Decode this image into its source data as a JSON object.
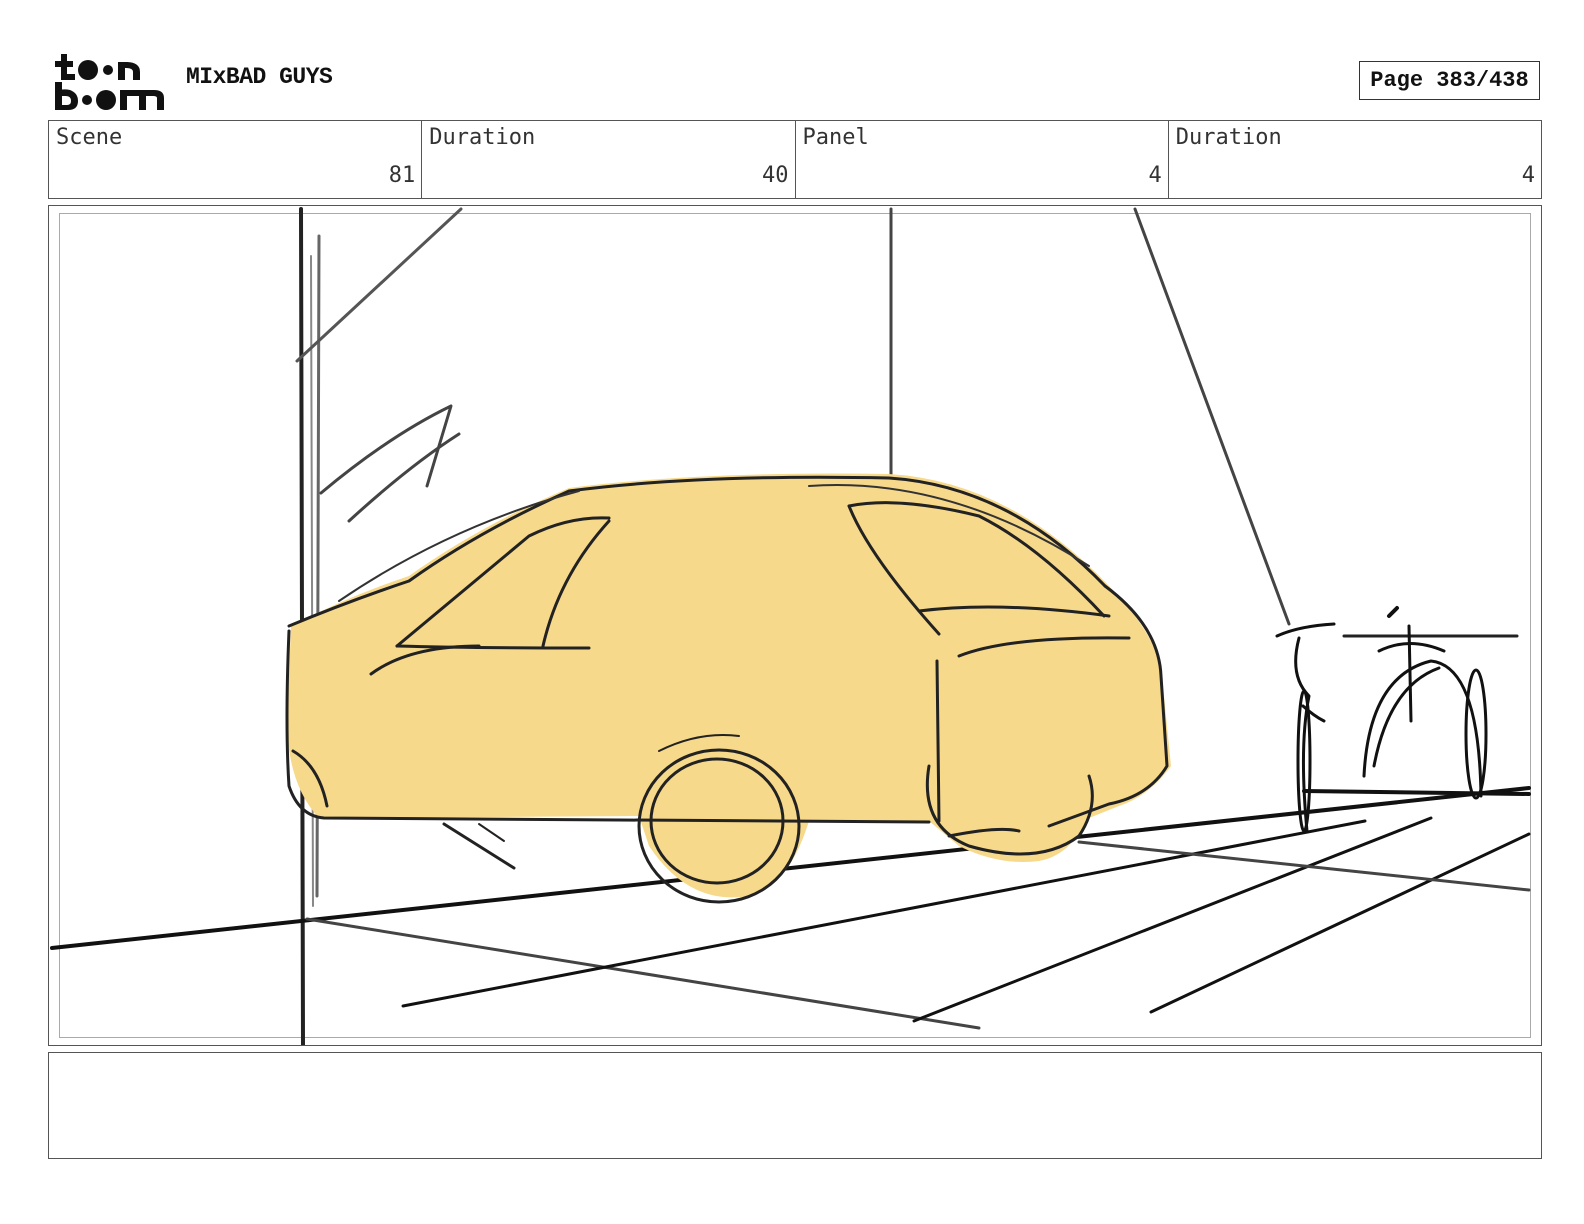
{
  "header": {
    "logo_alt": "toon boom",
    "project_title": "MIxBAD GUYS",
    "page_label": "Page 383/438"
  },
  "info": {
    "scene_label": "Scene",
    "scene_value": "81",
    "scene_duration_label": "Duration",
    "scene_duration_value": "40",
    "panel_label": "Panel",
    "panel_value": "4",
    "panel_duration_label": "Duration",
    "panel_duration_value": "4"
  },
  "panel": {
    "image_subject": "sketch of a yellow car parked on a street",
    "car_fill_color": "#f7d98b"
  },
  "notes": {
    "text": ""
  }
}
